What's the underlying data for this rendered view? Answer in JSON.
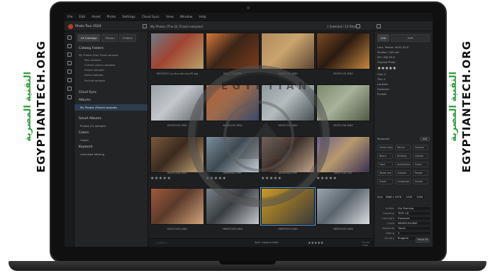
{
  "brand": {
    "domain_text": "EGYPTIANTECH.ORG",
    "arabic_text": "التقنية المصرية",
    "watermark_text": "EGYPTIAN",
    "green": "#2f9e3b"
  },
  "menubar": [
    "File",
    "Edit",
    "Asset",
    "Photo",
    "Settings",
    "Cloud Sync",
    "View",
    "Window",
    "Help"
  ],
  "toolbar": {
    "catalog_title": "Photo Tour 2024",
    "path": "My Photos (The Q) (Travel samples)",
    "selection": "1 Selected / 24 Total"
  },
  "left": {
    "tabs": [
      "All Catalogs",
      "Photos",
      "Folders"
    ],
    "catalog_folders": "Catalog Folders",
    "tree": [
      "My Photos (the) Travel samples",
      "Mini samples",
      "Current Library samples",
      "Import samples",
      "Demo samples",
      "Portrait samples"
    ],
    "cloud_sync": "Cloud Sync",
    "albums": "Albums",
    "album_item": "My Photos (Travel) samples",
    "smart_albums": "Smart Albums",
    "smart_item": "Photos (C) samples",
    "color": "Colors",
    "color_item": "Colors",
    "keywords": "Keyword",
    "keywords_item": "Unlimited filtering"
  },
  "grid": [
    {
      "name": "IMGP0037-ou-dou-abi-sky-85.jpg",
      "colors": [
        "#6e7a86",
        "#b8a36a",
        "#a04432"
      ]
    },
    {
      "name": "IMG_0792.PEF",
      "colors": [
        "#d67a36",
        "#7a3b1c",
        "#3b2518"
      ]
    },
    {
      "name": "IMGP0132.DNG",
      "colors": [
        "#b38a5c",
        "#5c4530",
        "#c9a46e"
      ]
    },
    {
      "name": "IMGP0133.DNG",
      "colors": [
        "#7a4a24",
        "#c8873e",
        "#2a1a10"
      ]
    },
    {
      "name": "IMGP0195.DNG",
      "colors": [
        "#9aa0a6",
        "#5c6166",
        "#c4c8cc"
      ]
    },
    {
      "name": "IMGP0202.DNG",
      "colors": [
        "#b5643c",
        "#364a6a",
        "#9c6a4a"
      ]
    },
    {
      "name": "IMGP0215.DNG",
      "colors": [
        "#8f9a9c",
        "#474f52",
        "#b3bcbe"
      ]
    },
    {
      "name": "IMGP1196.DNG",
      "colors": [
        "#7c8a6e",
        "#4d5a46",
        "#a9b29a"
      ]
    },
    {
      "name": "IMGP0256.DNG",
      "colors": [
        "#7a5a40",
        "#c9a77a",
        "#3a2a1e"
      ]
    },
    {
      "name": "IMGP0617.PEF",
      "colors": [
        "#7c8f9e",
        "#c8d0d6",
        "#3e4a52"
      ]
    },
    {
      "name": "IMGP0653.PEF",
      "colors": [
        "#8a7060",
        "#c4a88e",
        "#3a2e28"
      ]
    },
    {
      "name": "IMGP7287.PEF",
      "colors": [
        "#6a5b8a",
        "#3a3052",
        "#b89a6e"
      ]
    },
    {
      "name": "DSC02345.DNG",
      "colors": [
        "#a05a3c",
        "#d1a37a",
        "#5a3a2a"
      ]
    },
    {
      "name": "YBMP0769.DNG",
      "colors": [
        "#7a8188",
        "#c4c8cc",
        "#3a3e42"
      ]
    },
    {
      "name": "YBMP0339.DNG",
      "colors": [
        "#c89a2a",
        "#3a3a3a",
        "#8a6e2a"
      ]
    },
    {
      "name": "YBMP0345.DNG",
      "colors": [
        "#9aa6ae",
        "#d8dde0",
        "#5a646c"
      ]
    }
  ],
  "stars_row": "★★★★★",
  "bottombar": {
    "sort_label": "Sort: Capture Date",
    "search_placeholder": "Photo Filter",
    "palette": [
      "#c0392b",
      "#d4a12a",
      "#27ae60",
      "#2e86c1",
      "#8e44ad",
      "#7f8c8d"
    ]
  },
  "right": {
    "tabs": [
      "Info",
      "Edit"
    ],
    "summary": [
      "Lens: Pentax 16-50 f/2.8",
      "Shutter: 1/40 sec",
      "ISO: 400  f/5.6",
      "Original Photo"
    ],
    "rating": "★★★★★",
    "rows": [
      "Hue: 0",
      "Tint: 0",
      "Location",
      "Exposure",
      "Presets"
    ],
    "keywords_label": "Keywords",
    "keyword_add": "Add",
    "keywords": [
      [
        "Ocean wave",
        "Nature",
        "Summer"
      ],
      [
        "Beach",
        "Building",
        "Canada"
      ],
      [
        "Food",
        "Architecture",
        "Green"
      ],
      [
        "Street rain",
        "Outdoor",
        "People"
      ],
      [
        "Travel",
        "Landscape",
        "Sunset"
      ]
    ],
    "dim_label": "Size",
    "dim_values": [
      "3968 x 2976",
      "1200",
      "1000"
    ],
    "fields": [
      [
        "Author",
        "Dry Running"
      ],
      [
        "Headline",
        "TEST CD"
      ],
      [
        "Copyright",
        "Exposure"
      ],
      [
        "Credit",
        "IMGP0133.DNG"
      ],
      [
        "Keywords",
        "Travel"
      ],
      [
        "Rating",
        "3"
      ],
      [
        "Country",
        "Bulgaria"
      ]
    ],
    "reset_button": "Reset All"
  }
}
